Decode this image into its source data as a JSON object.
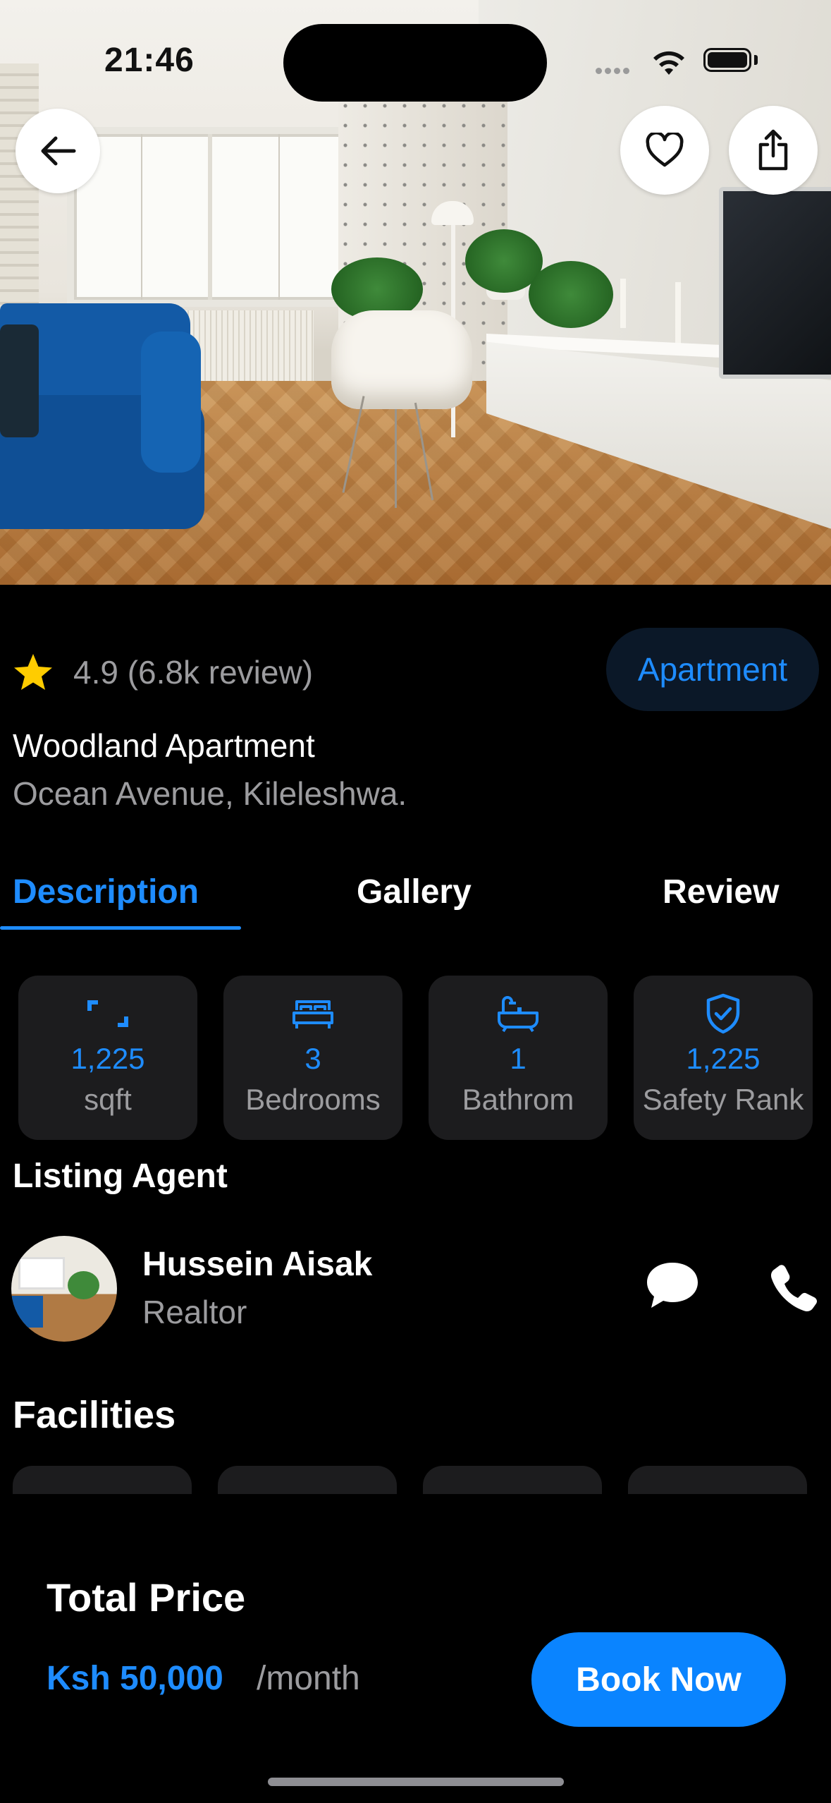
{
  "status_bar": {
    "time": "21:46"
  },
  "property": {
    "rating": "4.9",
    "reviews": "(6.8k review)",
    "type_badge": "Apartment",
    "name": "Woodland Apartment",
    "address": "Ocean Avenue, Kileleshwa."
  },
  "tabs": [
    {
      "label": "Description",
      "active": true
    },
    {
      "label": "Gallery",
      "active": false
    },
    {
      "label": "Review",
      "active": false
    }
  ],
  "stats": [
    {
      "icon": "area-icon",
      "value": "1,225",
      "label": "sqft"
    },
    {
      "icon": "bed-icon",
      "value": "3",
      "label": "Bedrooms"
    },
    {
      "icon": "bathtub-icon",
      "value": "1",
      "label": "Bathrom"
    },
    {
      "icon": "shield-check-icon",
      "value": "1,225",
      "label": "Safety Rank"
    }
  ],
  "agent": {
    "section_title": "Listing Agent",
    "name": "Hussein Aisak",
    "role": "Realtor"
  },
  "facilities": {
    "section_title": "Facilities"
  },
  "footer": {
    "total_label": "Total Price",
    "price": "Ksh 50,000",
    "period": "/month",
    "book_label": "Book Now"
  },
  "colors": {
    "accent": "#1e8cff",
    "card": "#1c1c1e",
    "muted": "#9c9c9f",
    "button": "#0a84ff",
    "star": "#ffcc00"
  }
}
